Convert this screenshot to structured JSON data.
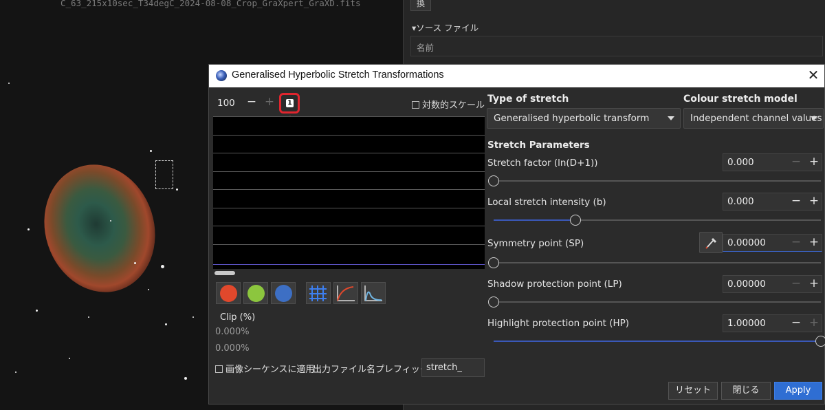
{
  "background": {
    "image_title": "C_63_215x10sec_T34degC_2024-08-08_Crop_GraXpert_GraXD.fits",
    "side_tab": "換",
    "section_label": "▾ソース ファイル",
    "name_column": "名前"
  },
  "dialog": {
    "title": "Generalised Hyperbolic Stretch Transformations",
    "close_glyph": "✕",
    "zoom": {
      "value": "100",
      "minus": "−",
      "plus": "+",
      "one_to_one": "1"
    },
    "log_scale_label": "対数的スケール",
    "clip": {
      "label": "Clip (%)",
      "low": "0.000%",
      "high": "0.000%"
    },
    "apply_to_sequence_label": "画像シーケンスに適用",
    "output_prefix_label": "出力ファイル名プレフィックス:",
    "output_prefix_value": "stretch_",
    "type_of_stretch": {
      "header": "Type of stretch",
      "value": "Generalised hyperbolic transform"
    },
    "colour_model": {
      "header": "Colour stretch model",
      "value": "Independent channel values"
    },
    "params_header": "Stretch Parameters",
    "params": {
      "stretch_factor": {
        "label": "Stretch factor (ln(D+1))",
        "value": "0.000",
        "position": 0.0
      },
      "local_intensity": {
        "label": "Local stretch intensity (b)",
        "value": "0.000",
        "position": 0.25
      },
      "symmetry_point": {
        "label": "Symmetry point (SP)",
        "value": "0.00000",
        "position": 0.0
      },
      "shadow_protection": {
        "label": "Shadow protection point (LP)",
        "value": "0.00000",
        "position": 0.0
      },
      "highlight_protection": {
        "label": "Highlight protection point (HP)",
        "value": "1.00000",
        "position": 1.0
      }
    },
    "buttons": {
      "reset": "リセット",
      "close": "閉じる",
      "apply": "Apply"
    },
    "colors": {
      "red": "#e0482c",
      "green": "#8cc63e",
      "blue": "#3d6fc4",
      "accent": "#2f6ed3",
      "highlight": "#e0252e"
    }
  }
}
